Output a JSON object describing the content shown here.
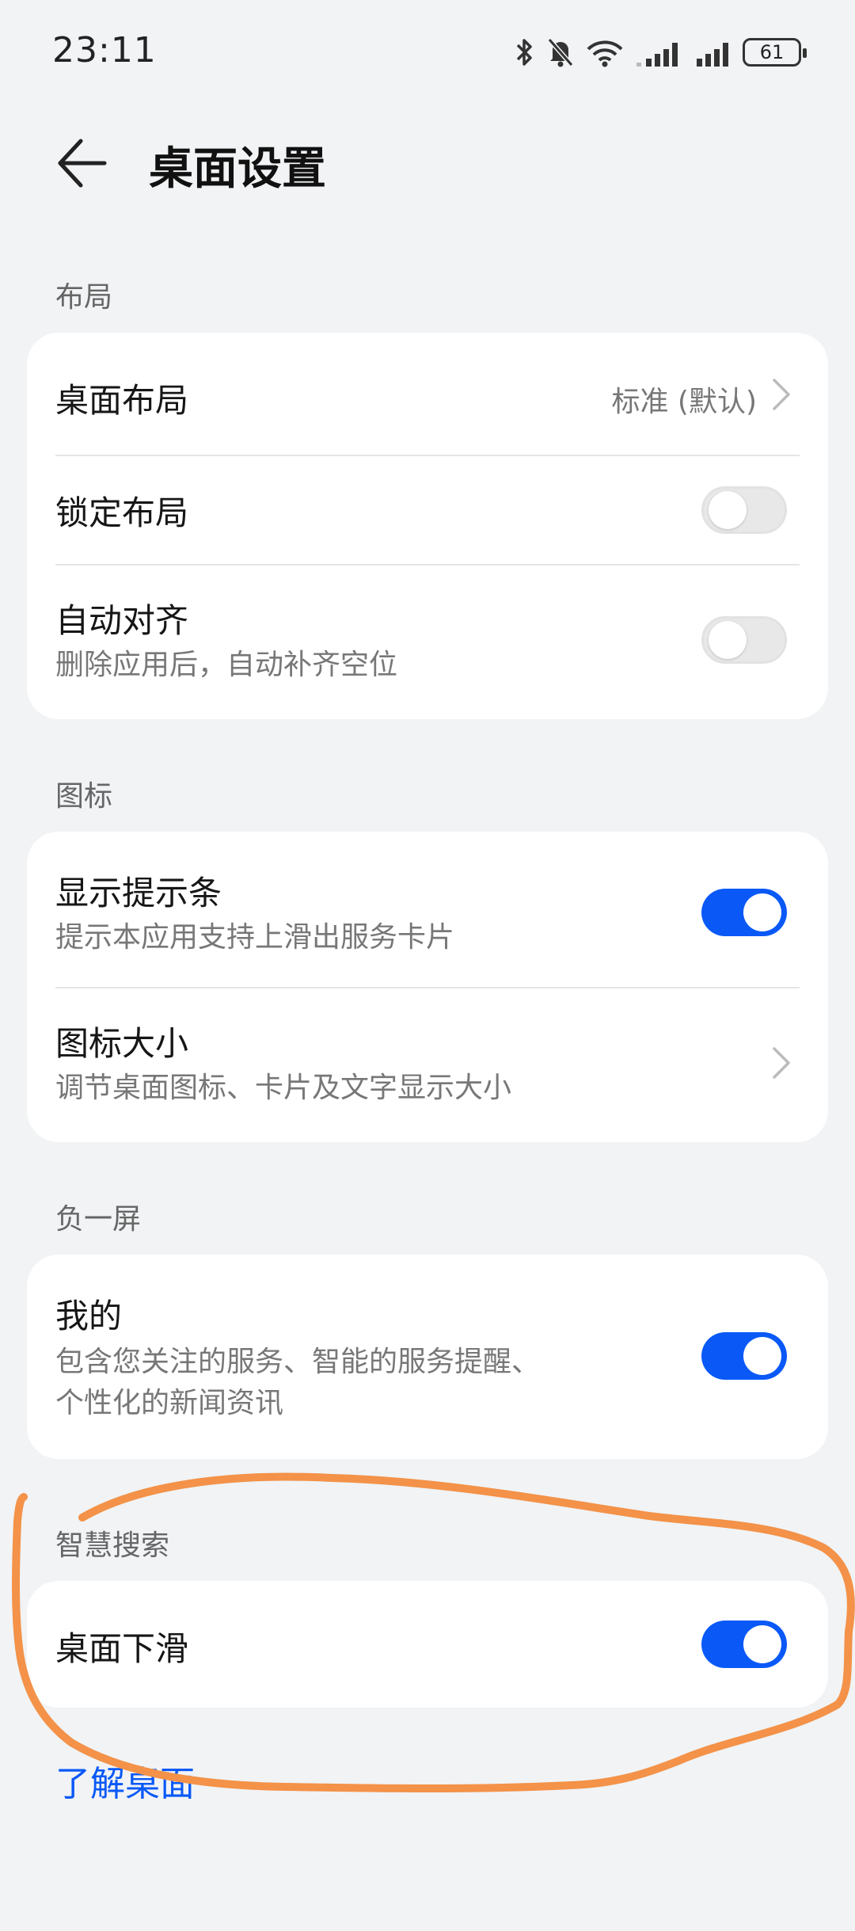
{
  "status_bar": {
    "time": "23:11",
    "battery": "61"
  },
  "header": {
    "title": "桌面设置"
  },
  "sections": {
    "layout": {
      "label": "布局",
      "desktop_layout": {
        "title": "桌面布局",
        "value": "标准 (默认)"
      },
      "lock_layout": {
        "title": "锁定布局",
        "enabled": false
      },
      "auto_align": {
        "title": "自动对齐",
        "subtitle": "删除应用后，自动补齐空位",
        "enabled": false
      }
    },
    "icons": {
      "label": "图标",
      "show_hint": {
        "title": "显示提示条",
        "subtitle": "提示本应用支持上滑出服务卡片",
        "enabled": true
      },
      "icon_size": {
        "title": "图标大小",
        "subtitle": "调节桌面图标、卡片及文字显示大小"
      }
    },
    "minus_one": {
      "label": "负一屏",
      "mine": {
        "title": "我的",
        "subtitle_line1": "包含您关注的服务、智能的服务提醒、",
        "subtitle_line2": "个性化的新闻资讯",
        "enabled": true
      }
    },
    "smart_search": {
      "label": "智慧搜索",
      "swipe_down": {
        "title": "桌面下滑",
        "enabled": true
      }
    }
  },
  "footer_link": "了解桌面",
  "colors": {
    "accent": "#0a59f7",
    "annotation": "#f39248",
    "background": "#f1f3f5"
  }
}
